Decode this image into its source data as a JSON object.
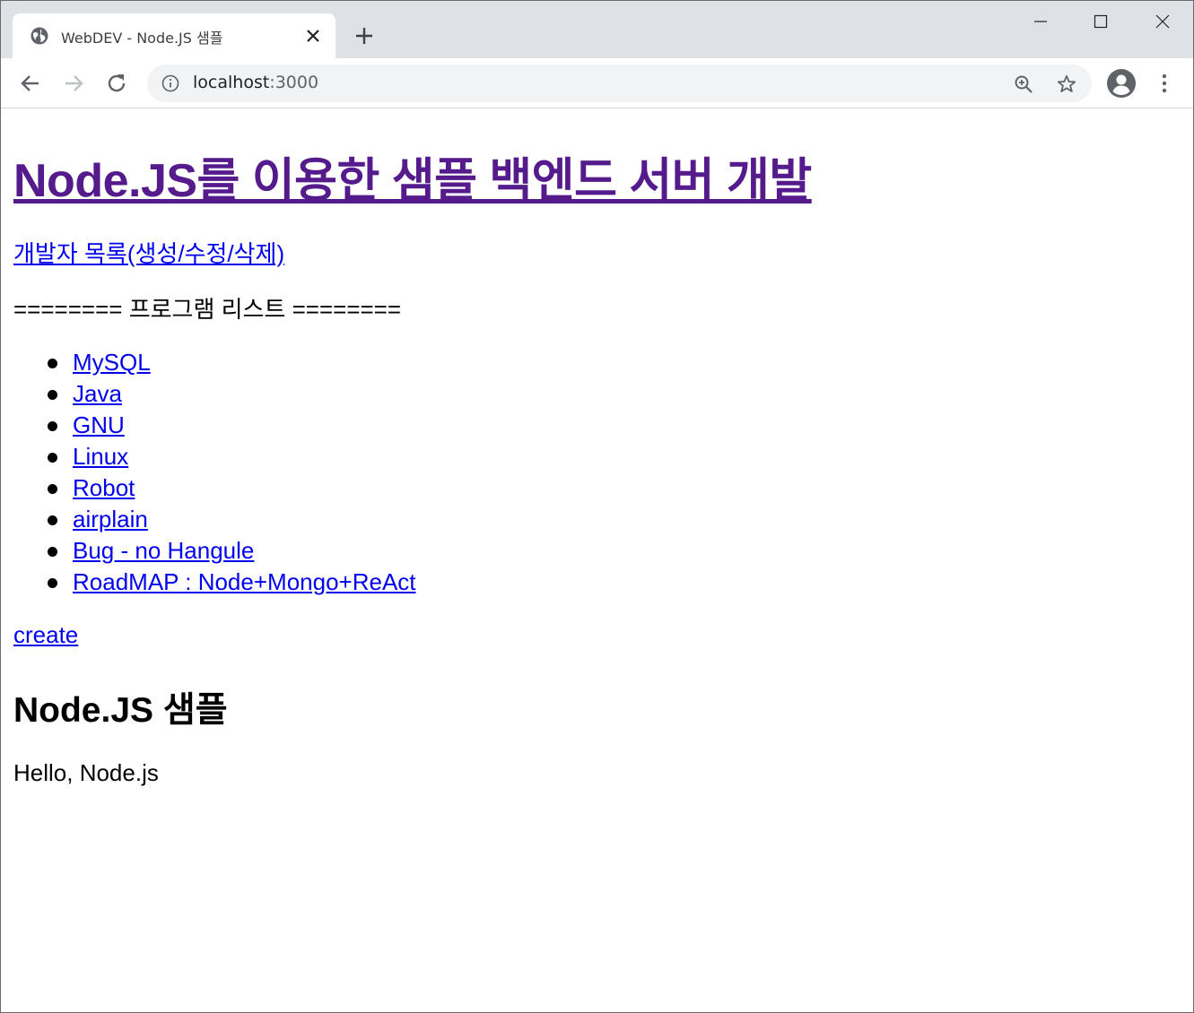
{
  "browser": {
    "tab": {
      "title": "WebDEV - Node.JS 샘플"
    },
    "address": {
      "host": "localhost",
      "port": ":3000"
    }
  },
  "page": {
    "heading": "Node.JS를 이용한 샘플 백엔드 서버 개발",
    "dev_link": "개발자 목록(생성/수정/삭제)",
    "program_banner": "======== 프로그램 리스트 ========",
    "programs": [
      "MySQL",
      "Java",
      "GNU",
      "Linux",
      "Robot",
      "airplain",
      "Bug - no Hangule",
      "RoadMAP : Node+Mongo+ReAct"
    ],
    "create_link": "create",
    "section_title": "Node.JS 샘플",
    "body_text": "Hello, Node.js"
  },
  "colors": {
    "visited_link": "#551a8b",
    "link": "#0000ee",
    "tabstrip": "#dee1e6",
    "omnibox": "#f1f3f4"
  },
  "icons": {
    "favicon": "globe-icon",
    "tab_close": "close-icon",
    "new_tab": "plus-icon",
    "back": "arrow-left-icon",
    "forward": "arrow-right-icon",
    "reload": "reload-icon",
    "site_info": "info-icon",
    "zoom": "zoom-in-icon",
    "bookmark": "star-icon",
    "profile": "account-icon",
    "menu": "kebab-menu-icon"
  }
}
